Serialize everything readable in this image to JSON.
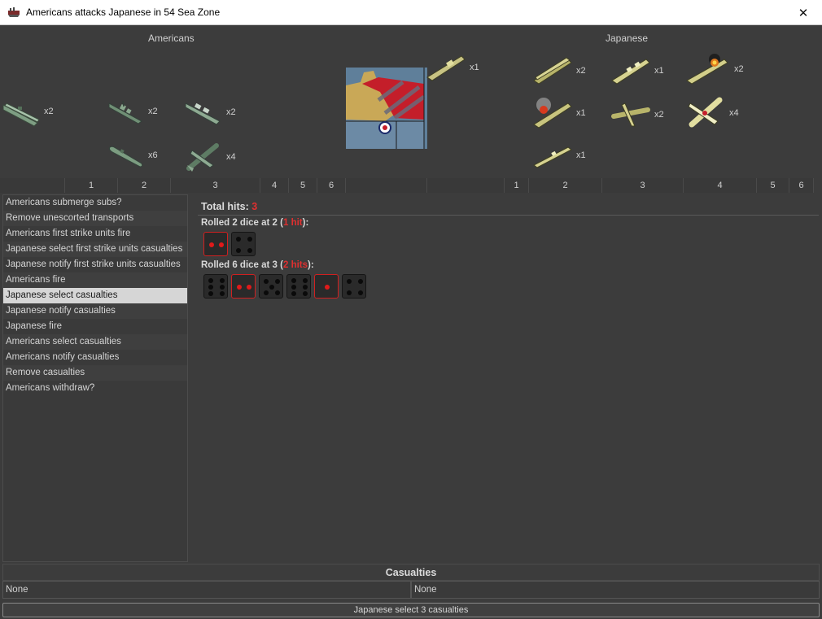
{
  "window": {
    "title": "Americans attacks Japanese in 54 Sea Zone",
    "close_glyph": "✕"
  },
  "attacker": {
    "name": "Americans",
    "units": [
      {
        "type": "carrier-icon",
        "count": "x2"
      },
      {
        "type": "battleship-icon",
        "count": "x2"
      },
      {
        "type": "cruiser-icon",
        "count": "x2"
      },
      {
        "type": "submarine-icon",
        "count": "x6"
      },
      {
        "type": "fighter-icon",
        "count": "x4"
      }
    ],
    "columns": [
      "",
      "1",
      "2",
      "3",
      "4",
      "5",
      "6"
    ]
  },
  "defender": {
    "name": "Japanese",
    "units": [
      {
        "type": "transport-icon",
        "count": "x1"
      },
      {
        "type": "carrier-icon",
        "count": "x2"
      },
      {
        "type": "cruiser-icon",
        "count": "x1"
      },
      {
        "type": "damaged-battleship-icon",
        "count": "x2"
      },
      {
        "type": "damaged-carrier-icon",
        "count": "x1"
      },
      {
        "type": "fighter-icon",
        "count": "x2"
      },
      {
        "type": "bomber-icon",
        "count": "x4"
      },
      {
        "type": "destroyer-icon",
        "count": "x1"
      }
    ],
    "columns": [
      "",
      "1",
      "2",
      "3",
      "4",
      "5",
      "6"
    ]
  },
  "steps": [
    "Americans submerge subs?",
    "Remove unescorted transports",
    "Americans first strike units fire",
    "Japanese select first strike units casualties",
    "Japanese notify first strike units casualties",
    "Americans fire",
    "Japanese select casualties",
    "Japanese notify casualties",
    "Japanese fire",
    "Americans select casualties",
    "Americans notify casualties",
    "Remove casualties",
    "Americans withdraw?"
  ],
  "selected_step_index": 6,
  "results": {
    "total_label": "Total hits: ",
    "total_value": "3",
    "rolls": [
      {
        "prefix": "Rolled 2 dice at 2 (",
        "hits": "1 hit",
        "suffix": "):",
        "dice": [
          {
            "value": 2,
            "hit": true
          },
          {
            "value": 4,
            "hit": false
          }
        ]
      },
      {
        "prefix": "Rolled 6 dice at 3 (",
        "hits": "2 hits",
        "suffix": "):",
        "dice": [
          {
            "value": 6,
            "hit": false
          },
          {
            "value": 2,
            "hit": true
          },
          {
            "value": 5,
            "hit": false
          },
          {
            "value": 6,
            "hit": false
          },
          {
            "value": 1,
            "hit": true
          },
          {
            "value": 4,
            "hit": false
          }
        ]
      }
    ]
  },
  "casualties": {
    "title": "Casualties",
    "left": "None",
    "right": "None"
  },
  "status_button": "Japanese select 3 casualties",
  "colors": {
    "us_unit": "#8aa88e",
    "jp_unit": "#cfcf86",
    "hit_red": "#e03030"
  }
}
